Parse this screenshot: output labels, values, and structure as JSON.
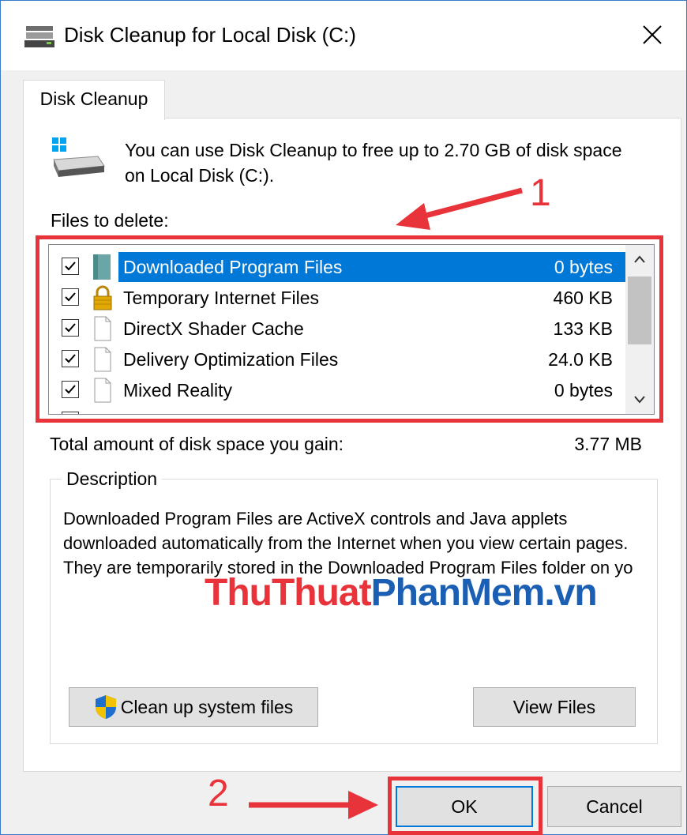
{
  "window": {
    "title": "Disk Cleanup for Local Disk (C:)",
    "accent_color": "#0078d7",
    "annotation_color": "#e8333a"
  },
  "tab": {
    "label": "Disk Cleanup"
  },
  "intro": {
    "text": "You can use Disk Cleanup to free up to 2.70 GB of disk space on Local Disk (C:)."
  },
  "files_to_delete": {
    "label": "Files to delete:",
    "items": [
      {
        "name": "Downloaded Program Files",
        "size": "0 bytes",
        "checked": true,
        "selected": true,
        "icon": "folder-icon"
      },
      {
        "name": "Temporary Internet Files",
        "size": "460 KB",
        "checked": true,
        "selected": false,
        "icon": "lock-icon"
      },
      {
        "name": "DirectX Shader Cache",
        "size": "133 KB",
        "checked": true,
        "selected": false,
        "icon": "file-icon"
      },
      {
        "name": "Delivery Optimization Files",
        "size": "24.0 KB",
        "checked": true,
        "selected": false,
        "icon": "file-icon"
      },
      {
        "name": "Mixed Reality",
        "size": "0 bytes",
        "checked": true,
        "selected": false,
        "icon": "file-icon"
      }
    ]
  },
  "total": {
    "label": "Total amount of disk space you gain:",
    "value": "3.77 MB"
  },
  "description": {
    "legend": "Description",
    "text": "Downloaded Program Files are ActiveX controls and Java applets downloaded automatically from the Internet when you view certain pages. They are temporarily stored in the Downloaded Program Files folder on yo"
  },
  "watermark": {
    "part1": "ThuThuat",
    "part2": "PhanMem",
    "part3": ".vn"
  },
  "buttons": {
    "cleanup_system": "Clean up system files",
    "view_files": "View Files",
    "ok": "OK",
    "cancel": "Cancel"
  },
  "annotations": {
    "step1": "1",
    "step2": "2"
  }
}
